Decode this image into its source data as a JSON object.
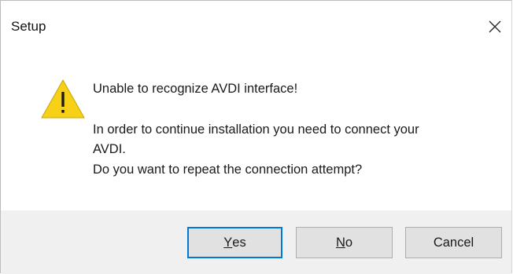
{
  "window": {
    "title": "Setup",
    "close_icon": "close-icon"
  },
  "message": {
    "icon": "warning-icon",
    "heading": "Unable to recognize AVDI interface!",
    "line1": "In order to continue installation you need to connect your",
    "line2": "AVDI.",
    "line3": "Do you want to repeat the connection attempt?"
  },
  "buttons": {
    "yes": {
      "accel": "Y",
      "rest": "es"
    },
    "no": {
      "accel": "N",
      "rest": "o"
    },
    "cancel": {
      "label": "Cancel"
    }
  },
  "colors": {
    "footer_bg": "#f0f0f0",
    "button_bg": "#e1e1e1",
    "default_button_border": "#0078d7",
    "warning_fill": "#f7d117"
  }
}
